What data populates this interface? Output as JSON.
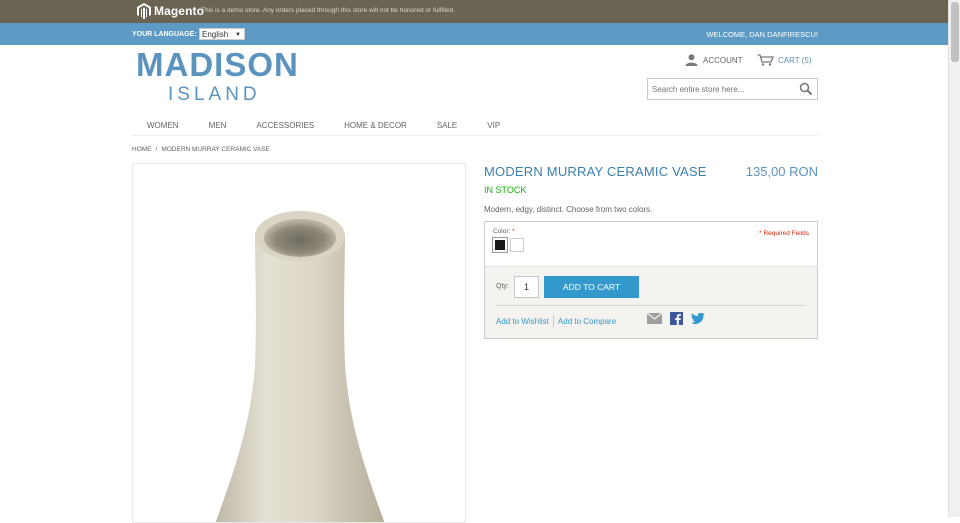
{
  "demo_bar": {
    "brand": "Magento",
    "notice": "This is a demo store. Any orders placed through this store will not be honored or fulfilled."
  },
  "lang_bar": {
    "label": "YOUR LANGUAGE:",
    "selected_language": "English",
    "welcome": "WELCOME, DAN DANFIRESCU!"
  },
  "header": {
    "logo_line1": "MADISON",
    "logo_line2": "ISLAND",
    "account_label": "ACCOUNT",
    "cart_label": "CART (5)",
    "search_placeholder": "Search entire store here..."
  },
  "nav": {
    "items": [
      "WOMEN",
      "MEN",
      "ACCESSORIES",
      "HOME & DECOR",
      "SALE",
      "VIP"
    ]
  },
  "breadcrumb": {
    "home": "HOME",
    "separator": "/",
    "current": "MODERN MURRAY CERAMIC VASE"
  },
  "product": {
    "name": "MODERN MURRAY CERAMIC VASE",
    "price": "135,00 RON",
    "stock": "IN STOCK",
    "description": "Modern, edgy, distinct. Choose from two colors.",
    "color_label": "Color:",
    "required_marker": "*",
    "required_fields": "* Required Fields",
    "swatches": [
      "black",
      "white"
    ],
    "qty_label": "Qty:",
    "qty_value": "1",
    "add_to_cart": "ADD TO CART",
    "wishlist": "Add to Wishlist",
    "compare": "Add to Compare"
  },
  "icons": {
    "account": "person-icon",
    "cart": "cart-icon",
    "search": "search-icon",
    "email": "email-icon",
    "facebook": "facebook-icon",
    "twitter": "twitter-icon"
  },
  "colors": {
    "demo_bar": "#6b6453",
    "lang_bar": "#5d9bc4",
    "brand_blue": "#5b93bf",
    "button_blue": "#3399cc",
    "in_stock_green": "#11b400",
    "required_red": "#df280a"
  }
}
